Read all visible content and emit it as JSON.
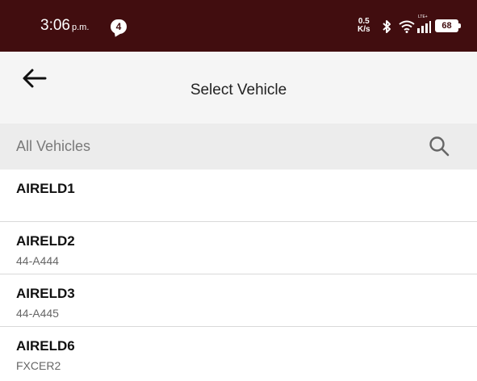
{
  "status_bar": {
    "time": "3:06",
    "ampm": "p.m.",
    "notification_count": "4",
    "net_speed_value": "0.5",
    "net_speed_unit": "K/s",
    "network_label": "LTE+",
    "battery": "68",
    "background_color": "#410d0f"
  },
  "header": {
    "title": "Select Vehicle",
    "back_icon": "arrow-left-icon"
  },
  "search": {
    "placeholder": "All Vehicles",
    "icon": "search-icon"
  },
  "vehicles": [
    {
      "name": "AIRELD1",
      "plate": ""
    },
    {
      "name": "AIRELD2",
      "plate": "44-A444"
    },
    {
      "name": "AIRELD3",
      "plate": "44-A445"
    },
    {
      "name": "AIRELD6",
      "plate": "FXCER2"
    }
  ]
}
